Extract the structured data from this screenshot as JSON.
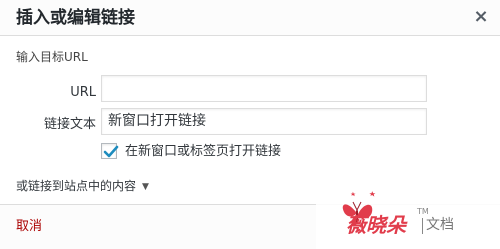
{
  "dialog": {
    "title": "插入或编辑链接",
    "close_label": "×"
  },
  "form": {
    "instruction": "输入目标URL",
    "url_label": "URL",
    "url_value": "",
    "text_label": "链接文本",
    "text_value": "新窗口打开链接",
    "new_tab_label": "在新窗口或标签页打开链接",
    "new_tab_checked": true
  },
  "existing_toggle": {
    "label": "或链接到站点中的内容",
    "arrow": "▼"
  },
  "footer": {
    "cancel_label": "取消"
  },
  "watermark": {
    "brand": "薇晓朵",
    "tm": "TM",
    "doc": "文档"
  },
  "colors": {
    "accent_check": "#1e8cbe",
    "cancel": "#aa0000",
    "brand": "#e13c4b"
  }
}
